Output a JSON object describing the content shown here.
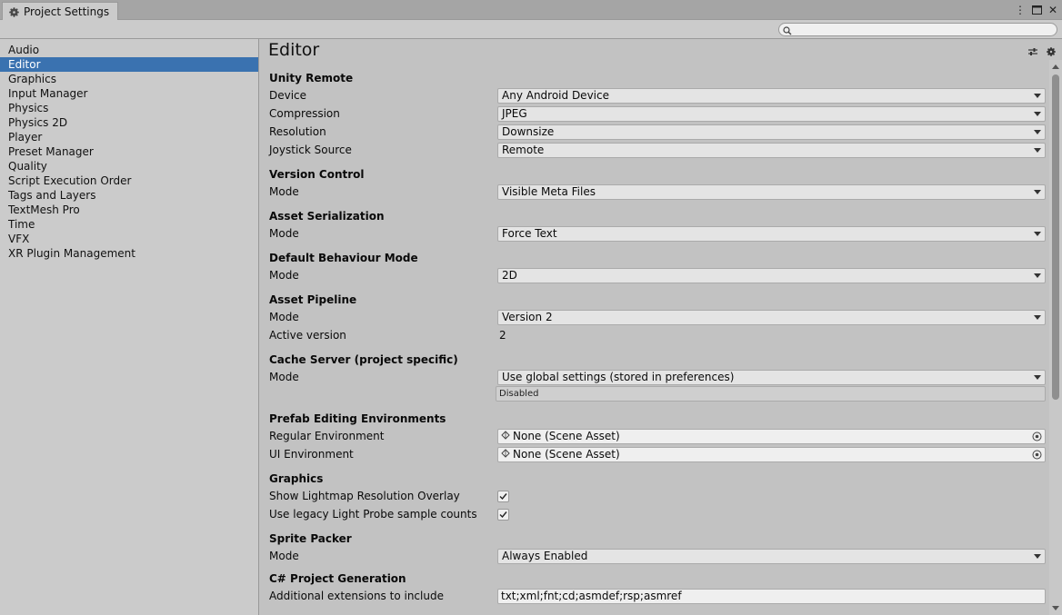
{
  "window": {
    "tab_title": "Project Settings",
    "icons": [
      "gear-icon",
      "more-icon",
      "maximize-icon",
      "close-icon"
    ]
  },
  "search": {
    "placeholder": ""
  },
  "sidebar": {
    "items": [
      {
        "label": "Audio"
      },
      {
        "label": "Editor",
        "active": true
      },
      {
        "label": "Graphics"
      },
      {
        "label": "Input Manager"
      },
      {
        "label": "Physics"
      },
      {
        "label": "Physics 2D"
      },
      {
        "label": "Player"
      },
      {
        "label": "Preset Manager"
      },
      {
        "label": "Quality"
      },
      {
        "label": "Script Execution Order"
      },
      {
        "label": "Tags and Layers"
      },
      {
        "label": "TextMesh Pro"
      },
      {
        "label": "Time"
      },
      {
        "label": "VFX"
      },
      {
        "label": "XR Plugin Management"
      }
    ]
  },
  "main": {
    "title": "Editor",
    "unity_remote": {
      "title": "Unity Remote",
      "device_label": "Device",
      "device_value": "Any Android Device",
      "compression_label": "Compression",
      "compression_value": "JPEG",
      "resolution_label": "Resolution",
      "resolution_value": "Downsize",
      "joystick_label": "Joystick Source",
      "joystick_value": "Remote"
    },
    "version_control": {
      "title": "Version Control",
      "mode_label": "Mode",
      "mode_value": "Visible Meta Files"
    },
    "asset_serialization": {
      "title": "Asset Serialization",
      "mode_label": "Mode",
      "mode_value": "Force Text"
    },
    "default_behaviour": {
      "title": "Default Behaviour Mode",
      "mode_label": "Mode",
      "mode_value": "2D"
    },
    "asset_pipeline": {
      "title": "Asset Pipeline",
      "mode_label": "Mode",
      "mode_value": "Version 2",
      "active_label": "Active version",
      "active_value": "2"
    },
    "cache_server": {
      "title": "Cache Server (project specific)",
      "mode_label": "Mode",
      "mode_value": "Use global settings (stored in preferences)",
      "status": "Disabled"
    },
    "prefab_env": {
      "title": "Prefab Editing Environments",
      "regular_label": "Regular Environment",
      "regular_value": "None (Scene Asset)",
      "ui_label": "UI Environment",
      "ui_value": "None (Scene Asset)"
    },
    "graphics": {
      "title": "Graphics",
      "lightmap_label": "Show Lightmap Resolution Overlay",
      "lightmap_checked": true,
      "probe_label": "Use legacy Light Probe sample counts",
      "probe_checked": true
    },
    "sprite_packer": {
      "title": "Sprite Packer",
      "mode_label": "Mode",
      "mode_value": "Always Enabled"
    },
    "csharp_gen": {
      "title": "C# Project Generation",
      "ext_label": "Additional extensions to include",
      "ext_value": "txt;xml;fnt;cd;asmdef;rsp;asmref"
    }
  }
}
